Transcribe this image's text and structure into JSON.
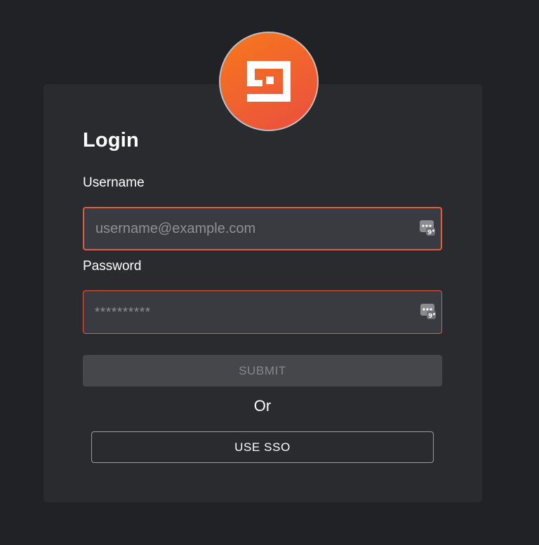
{
  "login": {
    "title": "Login",
    "username": {
      "label": "Username",
      "placeholder": "username@example.com",
      "value": ""
    },
    "password": {
      "label": "Password",
      "placeholder": "**********",
      "value": ""
    },
    "submit_label": "SUBMIT",
    "or_text": "Or",
    "sso_label": "USE SSO"
  },
  "icons": {
    "logo": "brand-logo-icon",
    "password_manager": "password-manager-icon"
  },
  "colors": {
    "background": "#212226",
    "card": "#2a2b2f",
    "accent": "#e45b43",
    "logo_gradient_start": "#f7791c",
    "logo_gradient_end": "#e9503c",
    "input_bg": "#393b40",
    "submit_disabled_bg": "#45474b"
  }
}
